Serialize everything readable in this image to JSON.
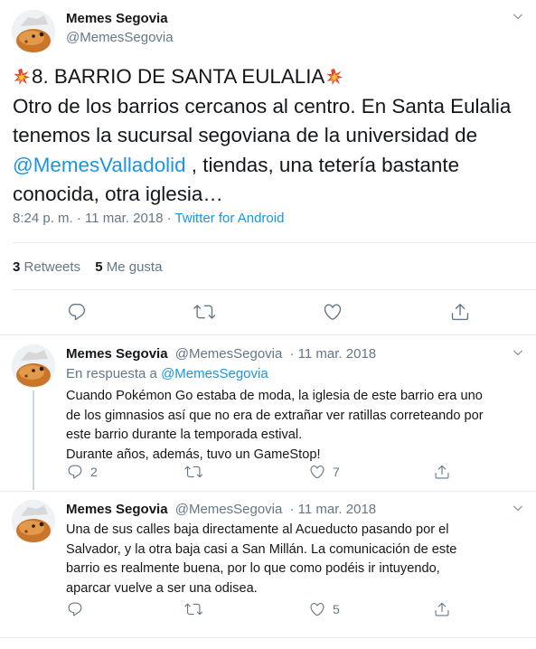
{
  "main": {
    "author_name": "Memes Segovia",
    "author_handle": "@MemesSegovia",
    "title_line": "8. BARRIO DE SANTA EULALIA",
    "text_1": "Otro de los barrios cercanos al centro. En Santa Eulalia",
    "text_2": "tenemos la sucursal segoviana de la universidad de",
    "mention": "@MemesValladolid",
    "text_3": " , tiendas, una tetería bastante",
    "text_4": "conocida, otra iglesia…",
    "time": "8:24 p. m. · 11 mar. 2018 · ",
    "source": "Twitter for Android",
    "retweets_count": "3",
    "retweets_label": "Retweets",
    "likes_count": "5",
    "likes_label": "Me gusta"
  },
  "replies": [
    {
      "author_name": "Memes Segovia",
      "author_handle": "@MemesSegovia",
      "date": "· 11 mar. 2018",
      "reply_to_label": "En respuesta a ",
      "reply_to_handle": "@MemesSegovia",
      "lines": [
        "Cuando Pokémon Go estaba de moda, la iglesia de este barrio era uno",
        "de los gimnasios así que no era de extrañar ver ratillas correteando por",
        "este barrio durante la temporada estival.",
        "Durante años, además, tuvo un GameStop!"
      ],
      "reply_count": "2",
      "like_count": "7"
    },
    {
      "author_name": "Memes Segovia",
      "author_handle": "@MemesSegovia",
      "date": "· 11 mar. 2018",
      "lines": [
        "Una de sus calles baja directamente al Acueducto pasando por el",
        "Salvador, y la otra baja casi a San Millán. La comunicación de este",
        "barrio es realmente buena, por lo que como podéis ir intuyendo,",
        "aparcar vuelve a ser una odisea."
      ],
      "like_count": "5"
    }
  ],
  "icons": {
    "collision": "collision-emoji",
    "reply": "reply-icon",
    "retweet": "retweet-icon",
    "like": "heart-icon",
    "share": "share-icon",
    "more": "chevron-down-icon"
  },
  "colors": {
    "link": "#1b95e0",
    "muted": "#657786",
    "text": "#14171a",
    "divider": "#e6ecf0"
  }
}
